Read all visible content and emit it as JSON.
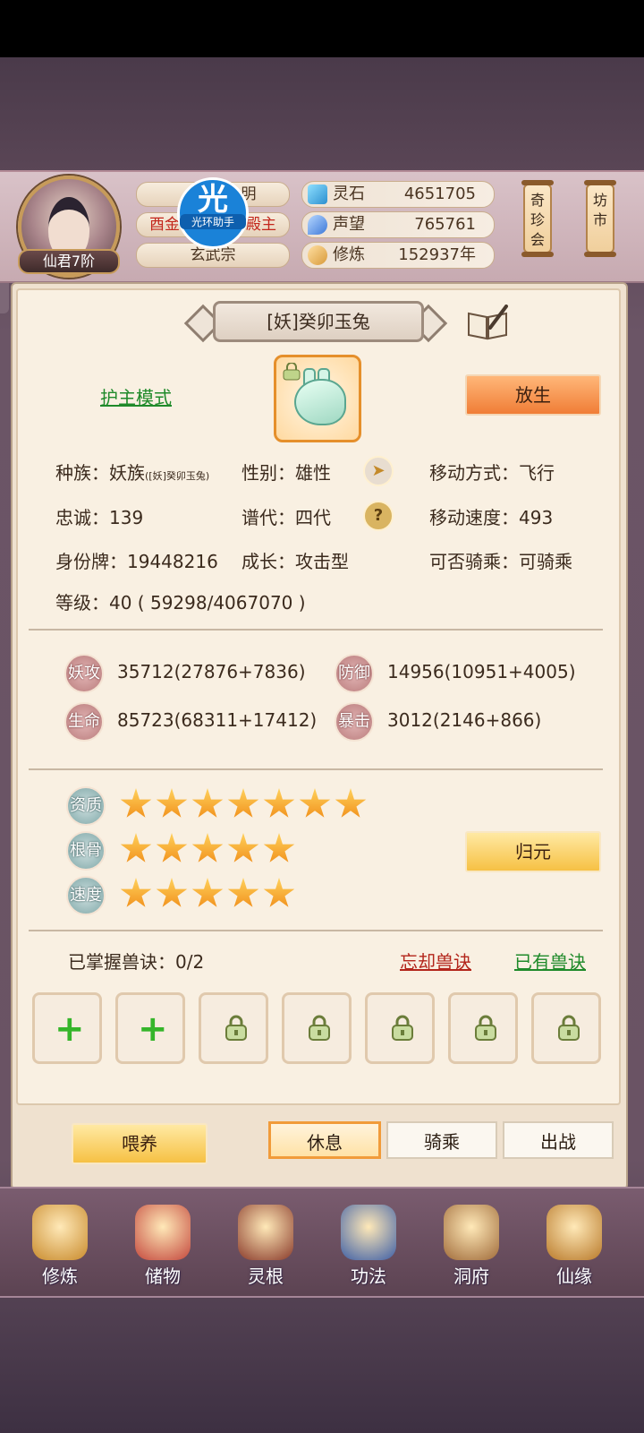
{
  "header": {
    "player_rank": "仙君7阶",
    "name_partial": "明",
    "title_left": "酉金",
    "title_right": "殿主",
    "sect": "玄武宗",
    "watermark_big": "光",
    "watermark_small": "光环助手",
    "resources": [
      {
        "label": "灵石",
        "value": "4651705",
        "icon": "spirit-stone-icon",
        "color": "#3fa5d8"
      },
      {
        "label": "声望",
        "value": "765761",
        "icon": "reputation-icon",
        "color": "#4b8fe0"
      },
      {
        "label": "修炼",
        "value": "152937年",
        "icon": "meditation-icon",
        "color": "#d89a3a"
      }
    ],
    "shop_tags": [
      "奇珍会",
      "坊市"
    ]
  },
  "pet": {
    "title": "[妖]癸卯玉兔",
    "mode_link": "护主模式",
    "release_button": "放生",
    "info": {
      "race_label": "种族：妖族",
      "race_detail": "([妖]癸卯玉兔)",
      "gender": "性别：雄性",
      "move_mode": "移动方式：飞行",
      "loyalty": "忠诚：139",
      "generation": "谱代：四代",
      "move_speed": "移动速度：493",
      "id_tag": "身份牌：19448216",
      "growth": "成长：攻击型",
      "rideable": "可否骑乘：可骑乘",
      "level": "等级：40 ( 59298/4067070 )"
    },
    "stats": [
      {
        "icon": "妖攻",
        "value": "35712(27876+7836)"
      },
      {
        "icon": "防御",
        "value": "14956(10951+4005)"
      },
      {
        "icon": "生命",
        "value": "85723(68311+17412)"
      },
      {
        "icon": "暴击",
        "value": "3012(2146+866)"
      }
    ],
    "aptitudes": [
      {
        "label": "资质",
        "stars": 7
      },
      {
        "label": "根骨",
        "stars": 5
      },
      {
        "label": "速度",
        "stars": 5
      }
    ],
    "reset_button": "归元",
    "skills_mastered": "已掌握兽诀：0/2",
    "forget_link": "忘却兽诀",
    "owned_link": "已有兽诀",
    "slots": [
      "plus",
      "plus",
      "locked",
      "locked",
      "locked",
      "locked",
      "locked"
    ]
  },
  "actions": {
    "feed": "喂养",
    "rest": "休息",
    "ride": "骑乘",
    "battle": "出战"
  },
  "nav": [
    {
      "label": "修炼",
      "icon": "cultivate-icon",
      "color": "#c98b2d"
    },
    {
      "label": "储物",
      "icon": "storage-bag-icon",
      "color": "#c4483d"
    },
    {
      "label": "灵根",
      "icon": "spirit-root-icon",
      "color": "#8a3b2b"
    },
    {
      "label": "功法",
      "icon": "technique-book-icon",
      "color": "#3e5fa6"
    },
    {
      "label": "洞府",
      "icon": "cave-house-icon",
      "color": "#a06b3a"
    },
    {
      "label": "仙缘",
      "icon": "fate-gourd-icon",
      "color": "#b97a2b"
    }
  ]
}
